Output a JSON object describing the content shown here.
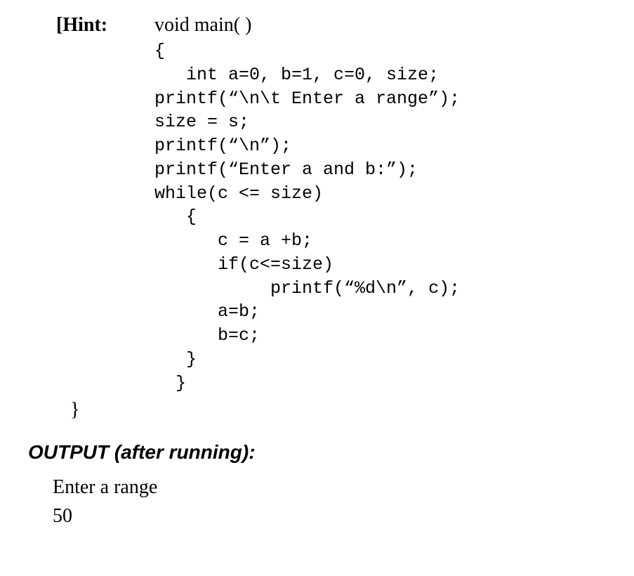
{
  "hint": {
    "label": "[Hint:",
    "signature": "void main( )"
  },
  "code": "{\n   int a=0, b=1, c=0, size;\nprintf(“\\n\\t Enter a range”);\nsize = s;\nprintf(“\\n”);\nprintf(“Enter a and b:”);\nwhile(c <= size)\n   {\n      c = a +b;\n      if(c<=size)\n           printf(“%d\\n”, c);\n      a=b;\n      b=c;\n   }\n  }",
  "close_brace": "}",
  "output": {
    "heading": "OUTPUT (after running):",
    "lines": {
      "line1": "Enter a range",
      "line2": "50"
    }
  }
}
